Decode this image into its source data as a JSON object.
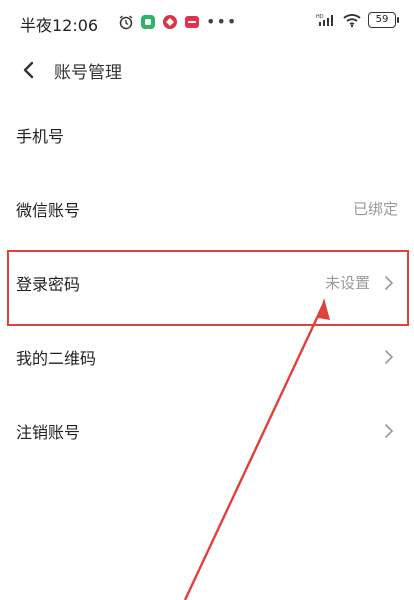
{
  "status_bar": {
    "time": "半夜12:06",
    "battery": "59",
    "icons": [
      "alarm-icon",
      "app-green-icon",
      "app-red-diamond-icon",
      "app-red-badge-icon",
      "more-dots-icon",
      "hd-signal-icon",
      "signal-icon",
      "wifi-icon",
      "battery-icon"
    ]
  },
  "header": {
    "title": "账号管理"
  },
  "rows": [
    {
      "label": "手机号",
      "value": "",
      "has_chevron": false
    },
    {
      "label": "微信账号",
      "value": "已绑定",
      "has_chevron": false
    },
    {
      "label": "登录密码",
      "value": "未设置",
      "has_chevron": true
    },
    {
      "label": "我的二维码",
      "value": "",
      "has_chevron": true
    },
    {
      "label": "注销账号",
      "value": "",
      "has_chevron": true
    }
  ],
  "colors": {
    "highlight": "#e0413c",
    "secondary_text": "#9a9a9a",
    "background": "#ffffff"
  }
}
